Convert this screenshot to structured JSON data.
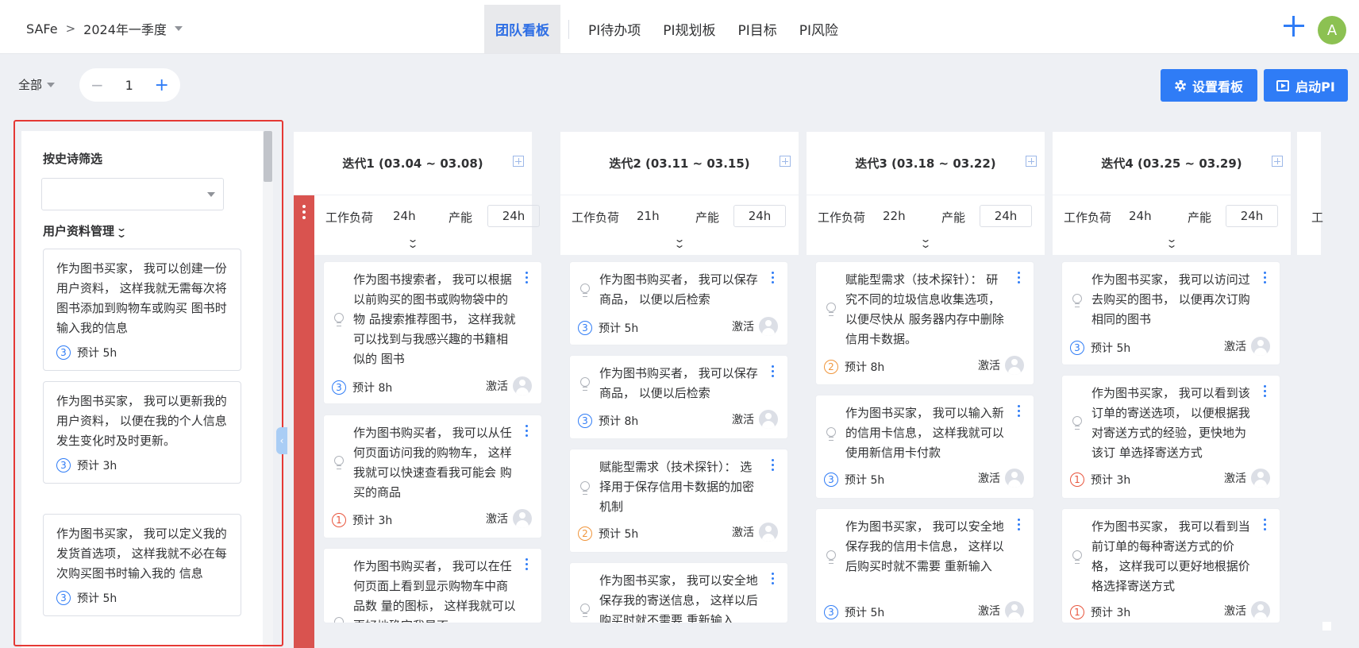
{
  "header": {
    "breadcrumb": {
      "root": "SAFe",
      "separator": ">",
      "current": "2024年一季度"
    },
    "tabs": [
      {
        "label": "团队看板",
        "active": true
      },
      {
        "label": "PI待办项"
      },
      {
        "label": "PI规划板"
      },
      {
        "label": "PI目标"
      },
      {
        "label": "PI风险"
      }
    ],
    "avatar_initial": "A"
  },
  "toolbar": {
    "scope": "全部",
    "stepper": {
      "minus": "−",
      "value": "1",
      "plus": "+"
    },
    "settings_button": "设置看板",
    "start_button": "启动PI"
  },
  "left_panel": {
    "filter_title": "按史诗筛选",
    "filter_value": "",
    "group_title": "用户资料管理",
    "cards": [
      {
        "text": "作为图书买家， 我可以创建一份用户资料， 这样我就无需每次将图书添加到购物车或购买 图书时输入我的信息",
        "priority": "3",
        "estimate": "预计 5h"
      },
      {
        "text": "作为图书买家， 我可以更新我的用户资料， 以便在我的个人信息发生变化时及时更新。",
        "priority": "3",
        "estimate": "预计 3h"
      },
      {
        "text": "作为图书买家， 我可以定义我的发货首选项， 这样我就不必在每次购买图书时输入我的 信息",
        "priority": "3",
        "estimate": "预计 5h"
      }
    ]
  },
  "iterations": [
    {
      "title": "迭代1 (03.04 ~ 03.08)",
      "workload_label": "工作负荷",
      "workload": "24h",
      "capacity_label": "产能",
      "capacity": "24h",
      "cards": [
        {
          "text": "作为图书搜索者， 我可以根据以前购买的图书或购物袋中的物 品搜索推荐图书， 这样我就可以找到与我感兴趣的书籍相似的 图书",
          "priority": "3",
          "estimate": "预计 8h",
          "status": "激活"
        },
        {
          "text": "作为图书购买者， 我可以从任何页面访问我的购物车， 这样我就可以快速查看我可能会 购买的商品",
          "priority": "1",
          "estimate": "预计 3h",
          "status": "激活"
        },
        {
          "text": "作为图书购买者， 我可以在任何页面上看到显示购物车中商品数 量的图标， 这样我就可以更好地确定我是否",
          "priority": "",
          "estimate": "",
          "status": ""
        }
      ]
    },
    {
      "title": "迭代2 (03.11 ~ 03.15)",
      "workload_label": "工作负荷",
      "workload": "21h",
      "capacity_label": "产能",
      "capacity": "24h",
      "cards": [
        {
          "text": "作为图书购买者， 我可以保存商品， 以便以后检索",
          "priority": "3",
          "estimate": "预计 5h",
          "status": "激活"
        },
        {
          "text": "作为图书购买者， 我可以保存商品， 以便以后检索",
          "priority": "3",
          "estimate": "预计 8h",
          "status": "激活"
        },
        {
          "text": "赋能型需求（技术探针）： 选择用于保存信用卡数据的加密机制",
          "priority": "2",
          "estimate": "预计 5h",
          "status": "激活"
        },
        {
          "text": "作为图书买家， 我可以安全地保存我的寄送信息， 这样以后购买时就不需要 重新输入",
          "priority": "",
          "estimate": "",
          "status": ""
        }
      ]
    },
    {
      "title": "迭代3 (03.18 ~ 03.22)",
      "workload_label": "工作负荷",
      "workload": "22h",
      "capacity_label": "产能",
      "capacity": "24h",
      "cards": [
        {
          "text": "赋能型需求（技术探针）： 研究不同的垃圾信息收集选项，以便尽快从 服务器内存中删除信用卡数据。",
          "priority": "2",
          "estimate": "预计 8h",
          "status": "激活"
        },
        {
          "text": "作为图书买家， 我可以输入新的信用卡信息， 这样我就可以使用新信用卡付款",
          "priority": "3",
          "estimate": "预计 5h",
          "status": "激活"
        },
        {
          "text": "作为图书买家， 我可以安全地保存我的信用卡信息， 这样以后购买时就不需要 重新输入",
          "priority": "3",
          "estimate": "预计 5h",
          "status": "激活"
        }
      ]
    },
    {
      "title": "迭代4 (03.25 ~ 03.29)",
      "workload_label": "工作负荷",
      "workload": "24h",
      "capacity_label": "产能",
      "capacity": "24h",
      "cards": [
        {
          "text": "作为图书买家， 我可以访问过去购买的图书， 以便再次订购相同的图书",
          "priority": "3",
          "estimate": "预计 5h",
          "status": "激活"
        },
        {
          "text": "作为图书买家， 我可以看到该订单的寄送选项， 以便根据我对寄送方式的经验，更快地为该订 单选择寄送方式",
          "priority": "1",
          "estimate": "预计 3h",
          "status": "激活"
        },
        {
          "text": "作为图书买家， 我可以看到当前订单的每种寄送方式的价格， 这样我可以更好地根据价格选择寄送方式",
          "priority": "1",
          "estimate": "预计 3h",
          "status": "激活"
        }
      ]
    }
  ],
  "next_column_stub": "工"
}
